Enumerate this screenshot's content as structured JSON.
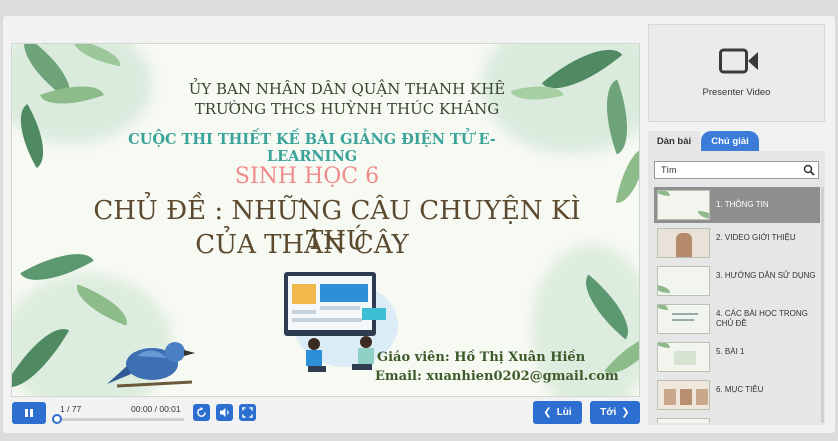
{
  "slide": {
    "org_line1": "ỦY BAN NHÂN DÂN QUẬN THANH KHÊ",
    "org_line2": "TRƯỜNG THCS HUỲNH THÚC KHÁNG",
    "contest": "CUỘC THI THIẾT KẾ BÀI GIẢNG ĐIỆN TỬ E-LEARNING",
    "subject": "SINH HỌC 6",
    "topic_line1": "CHỦ ĐỀ : NHỮNG CÂU CHUYỆN KÌ THÚ",
    "topic_line2": "CỦA THÂN CÂY",
    "teacher": "Giáo viên: Hồ Thị Xuân Hiền",
    "email": "Email: xuanhien0202@gmail.com"
  },
  "controls": {
    "slide_counter": "1 / 77",
    "time_readout": "00:00 / 00:01",
    "progress": 0.0,
    "back_label": "Lùi",
    "next_label": "Tới",
    "pause_icon": "pause-icon",
    "replay_icon": "replay-icon",
    "volume_icon": "volume-icon",
    "fullscreen_icon": "fullscreen-icon"
  },
  "sidebar": {
    "presenter_label": "Presenter Video",
    "presenter_icon": "video-camera-icon",
    "tabs": [
      {
        "label": "Dàn bài",
        "active": false
      },
      {
        "label": "Chú giải",
        "active": true
      }
    ],
    "search_placeholder": "Tìm",
    "outline": [
      {
        "label": "1. THÔNG TIN",
        "active": true
      },
      {
        "label": "2. VIDEO GIỚI THIỆU",
        "active": false
      },
      {
        "label": "3. HƯỚNG DẪN SỬ DỤNG",
        "active": false
      },
      {
        "label": "4. CÁC BÀI HỌC TRONG CHỦ ĐỀ",
        "active": false
      },
      {
        "label": "5. BÀI 1",
        "active": false
      },
      {
        "label": "6. MỤC TIÊU",
        "active": false
      }
    ]
  },
  "colors": {
    "accent": "#2d6fd1",
    "tab_active": "#3a7cd8",
    "active_item": "#8f8f8f",
    "contest_text": "#3aa39a",
    "subject_text": "#ef8b8b",
    "topic_text": "#5b4a2f"
  }
}
